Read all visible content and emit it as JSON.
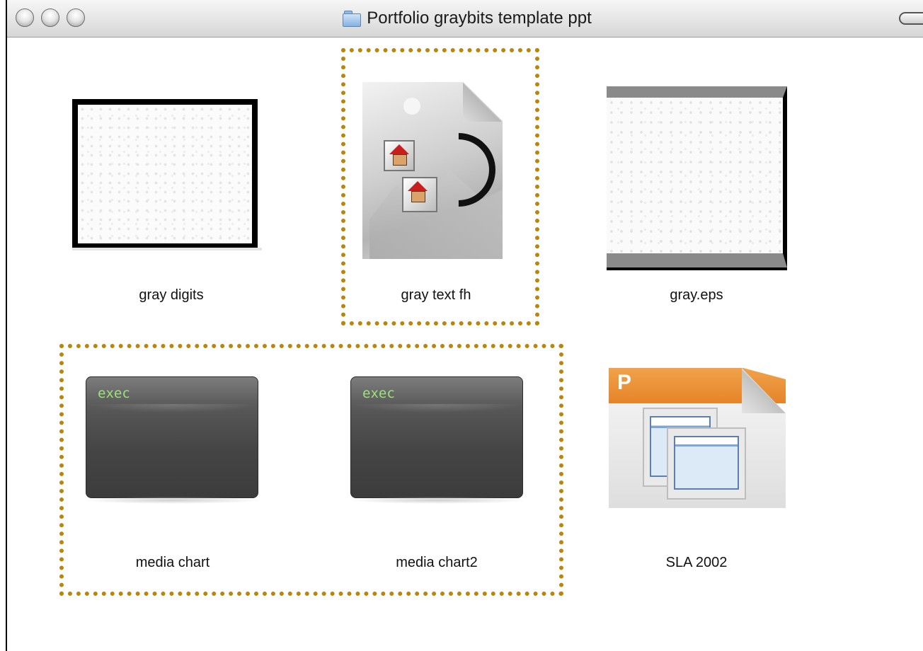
{
  "window": {
    "title": "Portfolio graybits template ppt",
    "title_icon": "folder-icon"
  },
  "files": [
    {
      "name": "gray digits",
      "icon": "gray-digits-thumbnail-icon",
      "selected": false
    },
    {
      "name": "gray text fh",
      "icon": "freehand-document-icon",
      "selected": true
    },
    {
      "name": "gray.eps",
      "icon": "eps-thumbnail-icon",
      "selected": false
    },
    {
      "name": "media chart",
      "icon": "exec-document-icon",
      "badge": "exec",
      "selected": true
    },
    {
      "name": "media chart2",
      "icon": "exec-document-icon",
      "badge": "exec",
      "selected": true
    },
    {
      "name": "SLA 2002",
      "icon": "powerpoint-document-icon",
      "badge": "P",
      "selected": false
    }
  ],
  "colors": {
    "selection_marquee": "#b8860b",
    "exec_text": "#9be27a",
    "powerpoint_orange": "#e5842a"
  }
}
